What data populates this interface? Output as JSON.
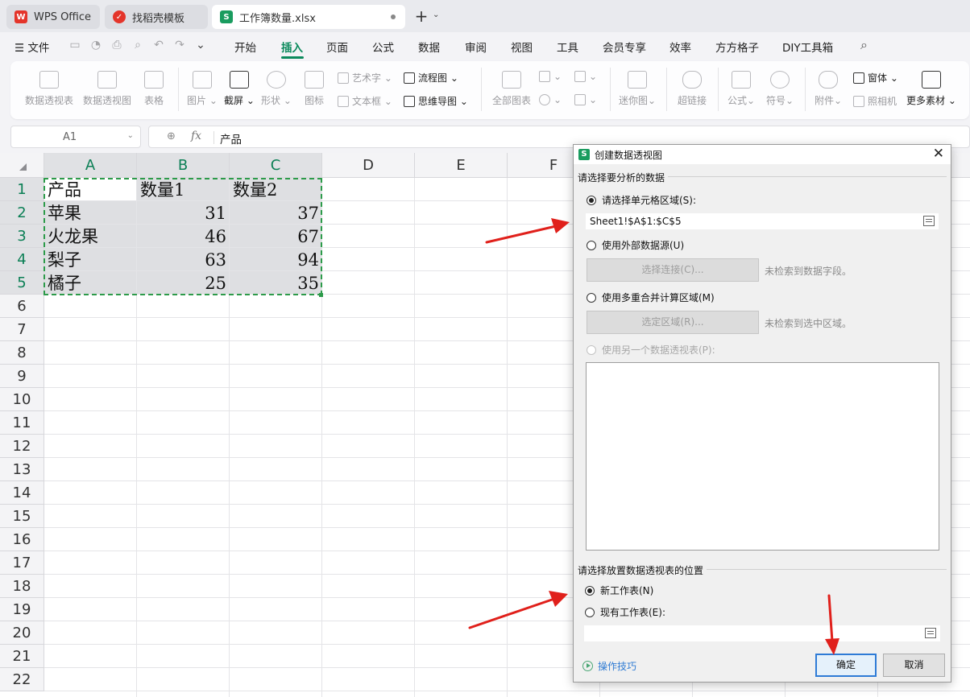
{
  "tabs": [
    {
      "label": "WPS Office",
      "icon": "wps-logo-icon"
    },
    {
      "label": "找稻壳模板",
      "icon": "docer-icon"
    },
    {
      "label": "工作簿数量.xlsx",
      "icon": "sheet-s-icon",
      "badge": "S"
    }
  ],
  "menu": {
    "file": "文件",
    "items": [
      "开始",
      "插入",
      "页面",
      "公式",
      "数据",
      "审阅",
      "视图",
      "工具",
      "会员专享",
      "效率",
      "方方格子",
      "DIY工具箱"
    ],
    "active": "插入"
  },
  "ribbon": {
    "pivot_table": "数据透视表",
    "pivot_chart": "数据透视图",
    "table": "表格",
    "picture": "图片",
    "screenshot": "截屏",
    "shape": "形状",
    "icon": "图标",
    "wordart": "艺术字",
    "textbox": "文本框",
    "flowchart": "流程图",
    "mindmap": "思维导图",
    "all_charts": "全部图表",
    "sparkline": "迷你图",
    "hyperlink": "超链接",
    "formula": "公式",
    "symbol": "符号",
    "attachment": "附件",
    "form": "窗体",
    "camera": "照相机",
    "more": "更多素材"
  },
  "formula_bar": {
    "name_box": "A1",
    "fx": "fx",
    "value": "产品"
  },
  "sheet": {
    "columns": [
      "A",
      "B",
      "C",
      "D",
      "E",
      "F"
    ],
    "rows": [
      "1",
      "2",
      "3",
      "4",
      "5",
      "6",
      "7",
      "8",
      "9",
      "10",
      "11",
      "12",
      "13",
      "14",
      "15",
      "16",
      "17",
      "18",
      "19",
      "20",
      "21",
      "22"
    ],
    "headers": [
      "产品",
      "数量1",
      "数量2"
    ],
    "data": [
      [
        "苹果",
        "31",
        "37"
      ],
      [
        "火龙果",
        "46",
        "67"
      ],
      [
        "梨子",
        "63",
        "94"
      ],
      [
        "橘子",
        "25",
        "35"
      ]
    ]
  },
  "dialog": {
    "title": "创建数据透视图",
    "icon_letter": "S",
    "section1": "请选择要分析的数据",
    "opt_range": "请选择单元格区域(S):",
    "range_value": "Sheet1!$A$1:$C$5",
    "opt_external": "使用外部数据源(U)",
    "btn_choose_conn": "选择连接(C)...",
    "hint_no_field": "未检索到数据字段。",
    "opt_multi": "使用多重合并计算区域(M)",
    "btn_select_range": "选定区域(R)...",
    "hint_no_range": "未检索到选中区域。",
    "opt_other_pivot": "使用另一个数据透视表(P):",
    "section2": "请选择放置数据透视表的位置",
    "opt_new_sheet": "新工作表(N)",
    "opt_existing_sheet": "现有工作表(E):",
    "tips": "操作技巧",
    "ok": "确定",
    "cancel": "取消"
  },
  "colors": {
    "accent_green": "#0b8a5c",
    "marquee_green": "#2d9b4a",
    "arrow_red": "#e0201b",
    "primary_button_border": "#2e7bd6"
  }
}
